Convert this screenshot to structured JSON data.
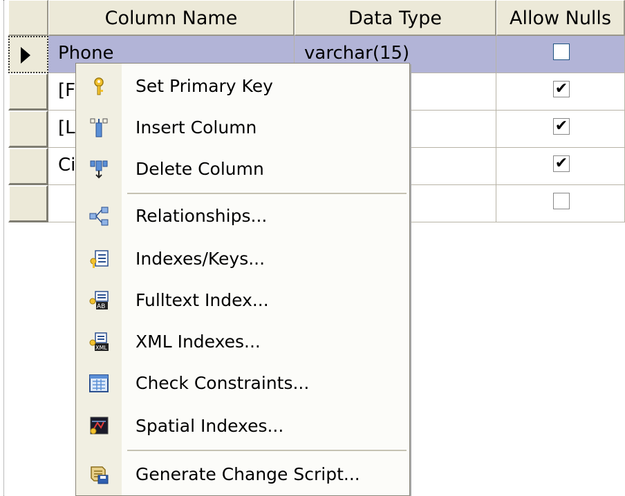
{
  "grid": {
    "headers": {
      "name": "Column Name",
      "type": "Data Type",
      "nulls": "Allow Nulls"
    },
    "rows": [
      {
        "name": "Phone",
        "type": "varchar(15)",
        "allow_nulls": false,
        "selected": true
      },
      {
        "name": "[F",
        "type": "",
        "allow_nulls": true
      },
      {
        "name": "[L",
        "type": "",
        "allow_nulls": true
      },
      {
        "name": "Ci",
        "type": "",
        "allow_nulls": true
      },
      {
        "name": "",
        "type": "",
        "allow_nulls": false
      }
    ],
    "checkmark": "✔"
  },
  "menu": {
    "items": [
      {
        "label": "Set Primary Key",
        "icon": "primary-key-icon"
      },
      {
        "label": "Insert Column",
        "icon": "insert-column-icon"
      },
      {
        "label": "Delete Column",
        "icon": "delete-column-icon"
      },
      {
        "label": "Relationships...",
        "icon": "relationships-icon"
      },
      {
        "label": "Indexes/Keys...",
        "icon": "indexes-keys-icon"
      },
      {
        "label": "Fulltext Index...",
        "icon": "fulltext-index-icon"
      },
      {
        "label": "XML Indexes...",
        "icon": "xml-indexes-icon"
      },
      {
        "label": "Check Constraints...",
        "icon": "check-constraints-icon"
      },
      {
        "label": "Spatial Indexes...",
        "icon": "spatial-indexes-icon"
      },
      {
        "label": "Generate Change Script...",
        "icon": "generate-script-icon"
      }
    ]
  }
}
